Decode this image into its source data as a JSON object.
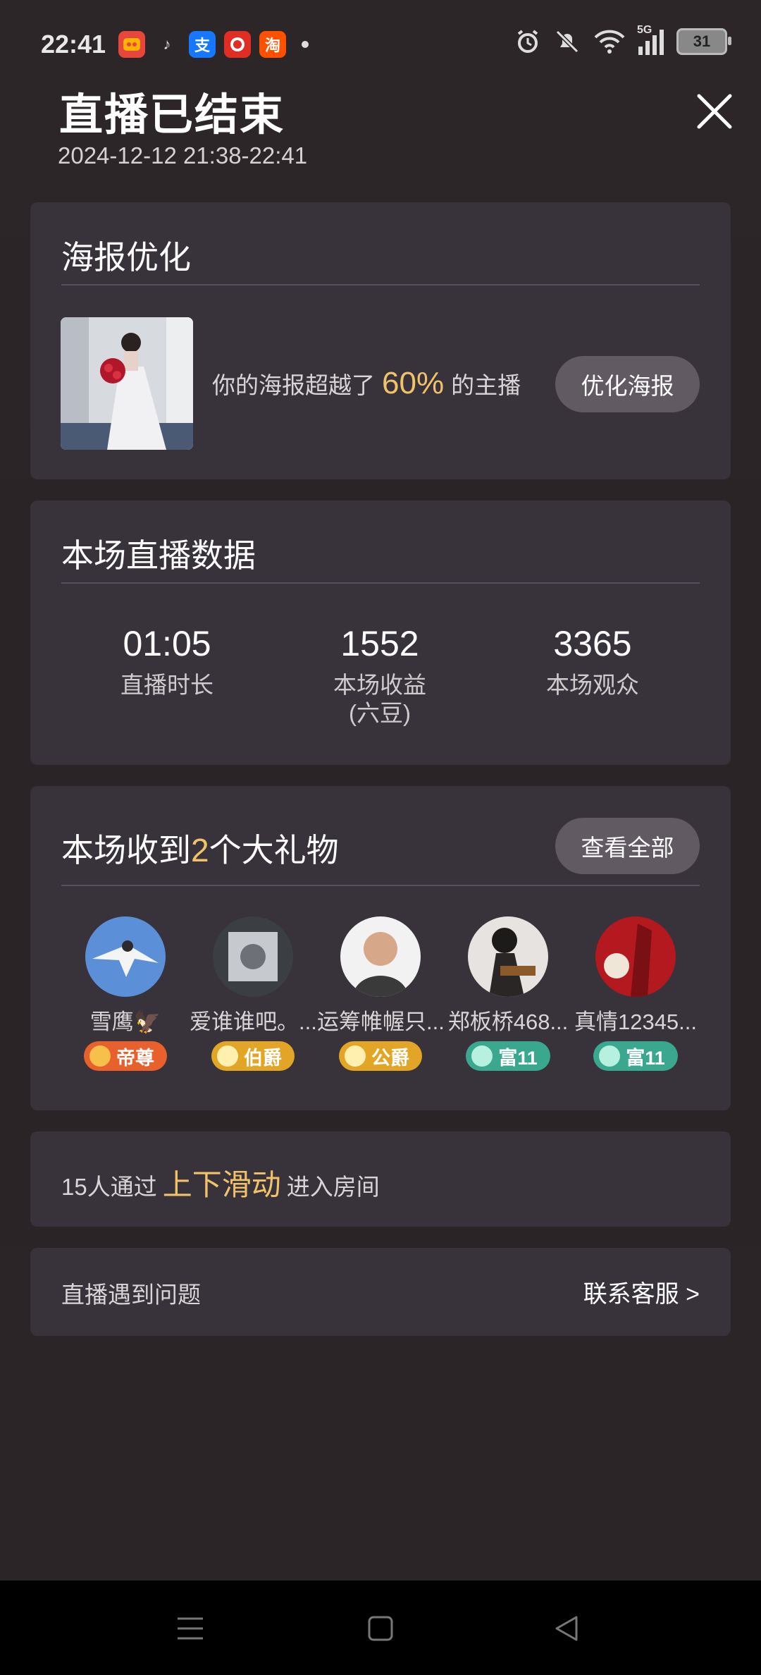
{
  "status_bar": {
    "time": "22:41",
    "battery": "31",
    "network": "5G",
    "app_icons": [
      {
        "name": "game-app-icon",
        "glyph": "",
        "color": "#e8453c"
      },
      {
        "name": "music-app-icon",
        "glyph": "♪",
        "color": "#2b2527"
      },
      {
        "name": "alipay-icon",
        "glyph": "支",
        "color": "#1677ff"
      },
      {
        "name": "pinduoduo-icon",
        "glyph": "",
        "color": "#e02e24"
      },
      {
        "name": "taobao-icon",
        "glyph": "淘",
        "color": "#ff5000"
      }
    ]
  },
  "header": {
    "title": "直播已结束",
    "subtitle": "2024-12-12 21:38-22:41"
  },
  "poster": {
    "title": "海报优化",
    "text_before": "你的海报超越了",
    "percent": "60%",
    "text_after": "的主播",
    "button": "优化海报"
  },
  "stats": {
    "title": "本场直播数据",
    "items": [
      {
        "value": "01:05",
        "label": "直播时长",
        "sub": ""
      },
      {
        "value": "1552",
        "label": "本场收益",
        "sub": "(六豆)"
      },
      {
        "value": "3365",
        "label": "本场观众",
        "sub": ""
      }
    ]
  },
  "gifts": {
    "title_before": "本场收到",
    "count": "2",
    "title_after": "个大礼物",
    "button": "查看全部",
    "gifters": [
      {
        "name": "雪鹰🦅",
        "badge": "帝尊",
        "badge_color": "#e8612c"
      },
      {
        "name": "爱谁谁吧。...",
        "badge": "伯爵",
        "badge_color": "#e2a525"
      },
      {
        "name": "运筹帷幄只...",
        "badge": "公爵",
        "badge_color": "#e2a525"
      },
      {
        "name": "郑板桥468...",
        "badge": "富11",
        "badge_color": "#3aa88f"
      },
      {
        "name": "真情12345...",
        "badge": "富11",
        "badge_color": "#3aa88f"
      }
    ]
  },
  "swipe": {
    "prefix": "15人通过",
    "highlight": "上下滑动",
    "suffix": "进入房间"
  },
  "help": {
    "text": "直播遇到问题",
    "link": "联系客服 >"
  }
}
